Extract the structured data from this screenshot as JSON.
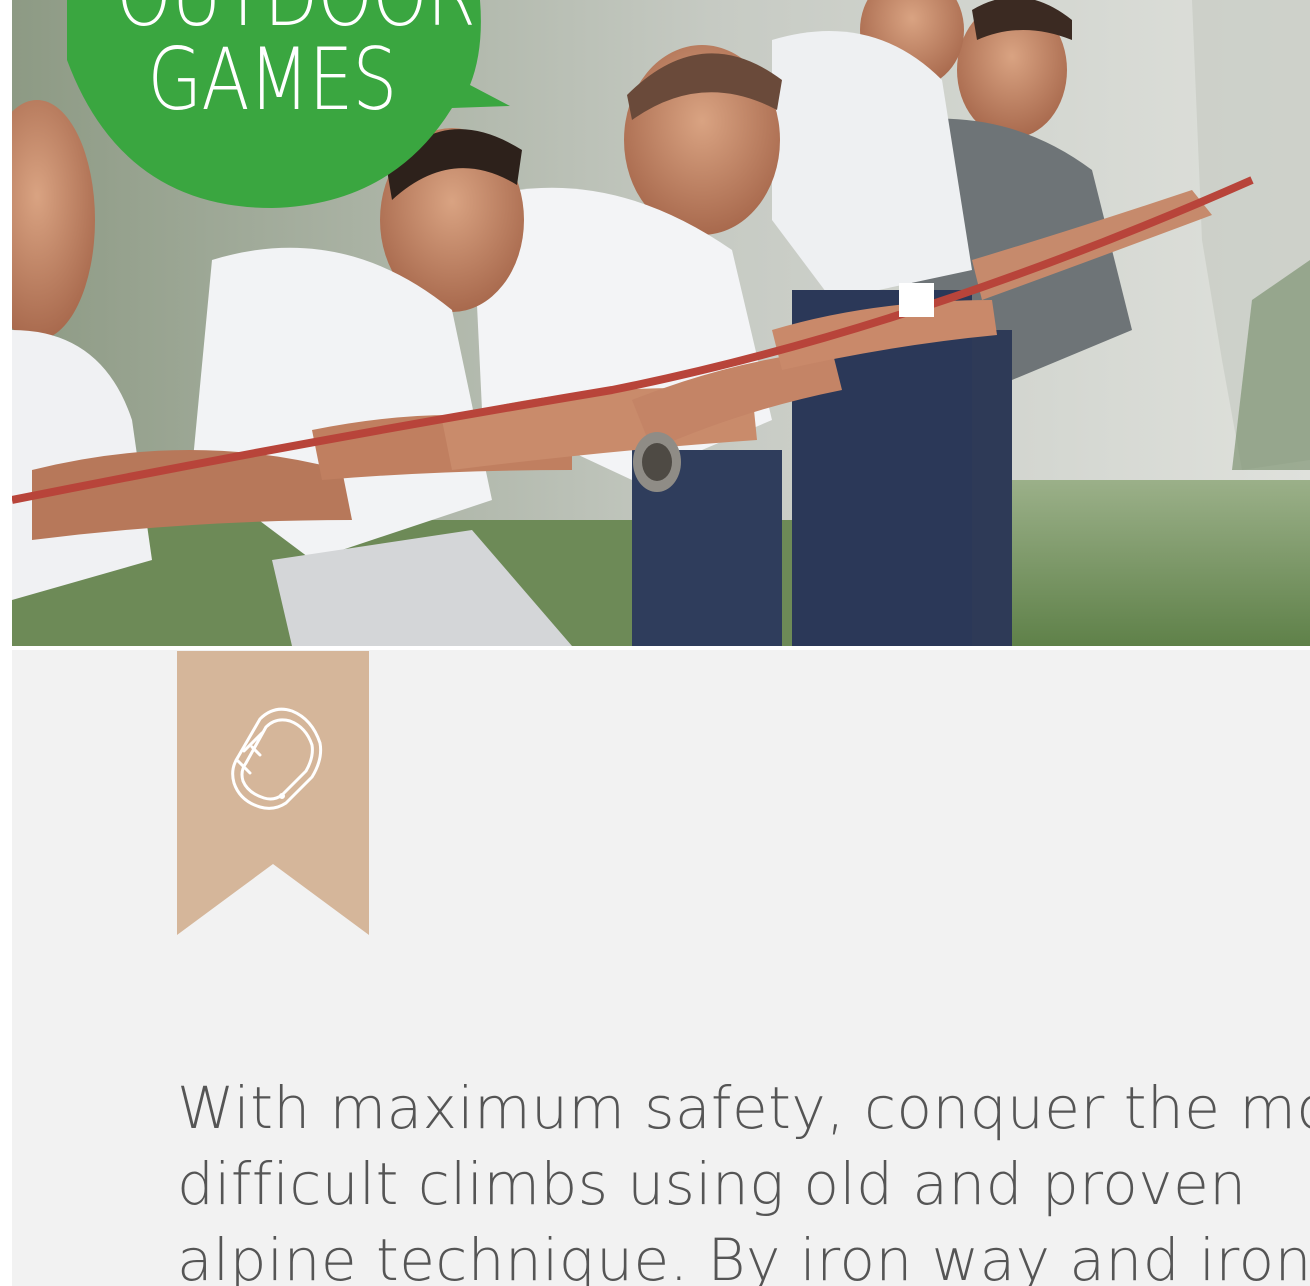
{
  "badge": {
    "line1": "OUTDOOR",
    "line2": "GAMES"
  },
  "hero": {
    "photo_name": "team-rope-photo"
  },
  "ribbon": {
    "icon": "carabiner-icon"
  },
  "description": {
    "line1": "With maximum safety, conquer the most",
    "line2": "difficult climbs using old and proven",
    "line3": "alpine technique. By iron way and iron"
  },
  "colors": {
    "badge_green": "#3aa640",
    "ribbon_tan": "#d5b69a",
    "background": "#f2f2f2",
    "text": "#555555"
  }
}
